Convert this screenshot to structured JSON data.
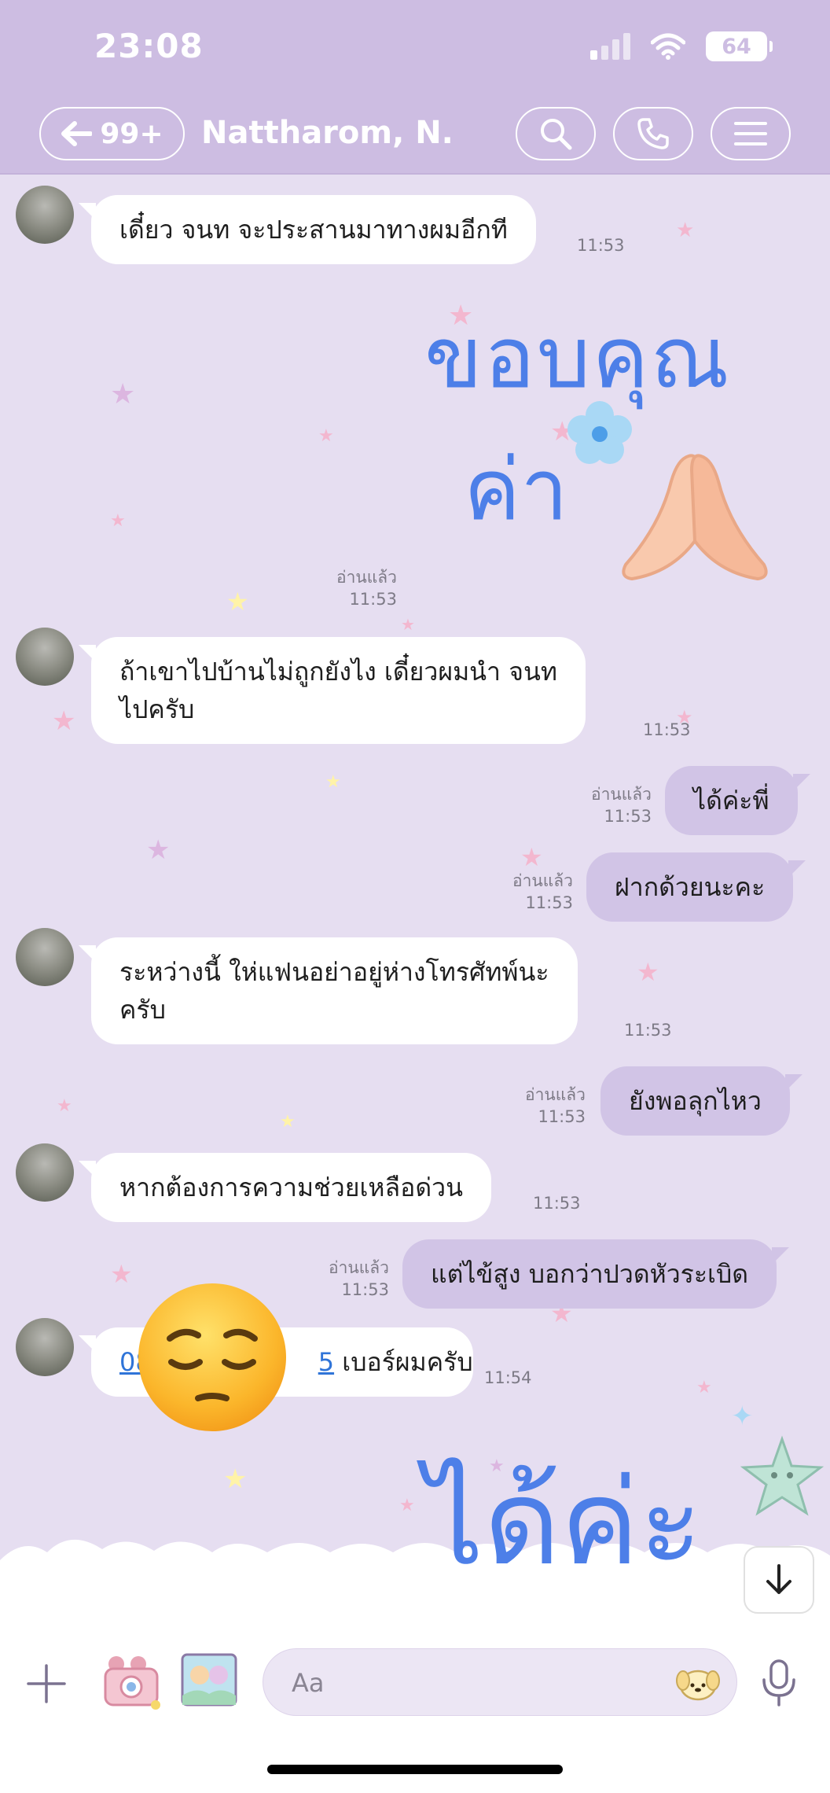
{
  "status_bar": {
    "time": "23:08",
    "battery": "64"
  },
  "header": {
    "back_count": "99+",
    "title": "Nattharom, N."
  },
  "messages": [
    {
      "text": "เดี๋ยว จนท จะประสานมาทางผมอีกที",
      "time": "11:53"
    },
    {
      "sticker_line1": "ขอบคุณ",
      "sticker_line2": "ค่า",
      "read": "อ่านแล้ว",
      "time": "11:53"
    },
    {
      "line1": "ถ้าเขาไปบ้านไม่ถูกยังไง เดี๋ยวผมนำ จนท",
      "line2": "ไปครับ",
      "time": "11:53"
    },
    {
      "text": "ได้ค่ะพี่",
      "read": "อ่านแล้ว",
      "time": "11:53"
    },
    {
      "text": "ฝากด้วยนะคะ",
      "read": "อ่านแล้ว",
      "time": "11:53"
    },
    {
      "line1": "ระหว่างนี้ ให่แฟนอย่าอยู่ห่างโทรศัทพ์นะ",
      "line2": "ครับ",
      "time": "11:53"
    },
    {
      "text": "ยังพอลุกไหว",
      "read": "อ่านแล้ว",
      "time": "11:53"
    },
    {
      "text": "หากต้องการความช่วยเหลือด่วน",
      "time": "11:53"
    },
    {
      "text": "แต่ไข้สูง บอกว่าปวดหัวระเบิด",
      "read": "อ่านแล้ว",
      "time": "11:53"
    },
    {
      "link_start": "08",
      "link_end": "5",
      "text": "เบอร์ผมครับ",
      "time": "11:54"
    },
    {
      "sticker_text": "ได้ค่ะ"
    }
  ],
  "composer": {
    "placeholder": "Aa"
  },
  "colors": {
    "header": "#cdbde2",
    "background": "#e6def1",
    "outgoing": "#d1c4e6",
    "incoming": "#ffffff",
    "sticker_text": "#4d7fe8"
  },
  "icons": [
    "back-arrow-icon",
    "search-icon",
    "phone-icon",
    "menu-icon",
    "plus-icon",
    "camera-sticker-icon",
    "gallery-icon",
    "sticker-icon",
    "microphone-icon",
    "scroll-down-icon",
    "pensive-face-emoji"
  ]
}
